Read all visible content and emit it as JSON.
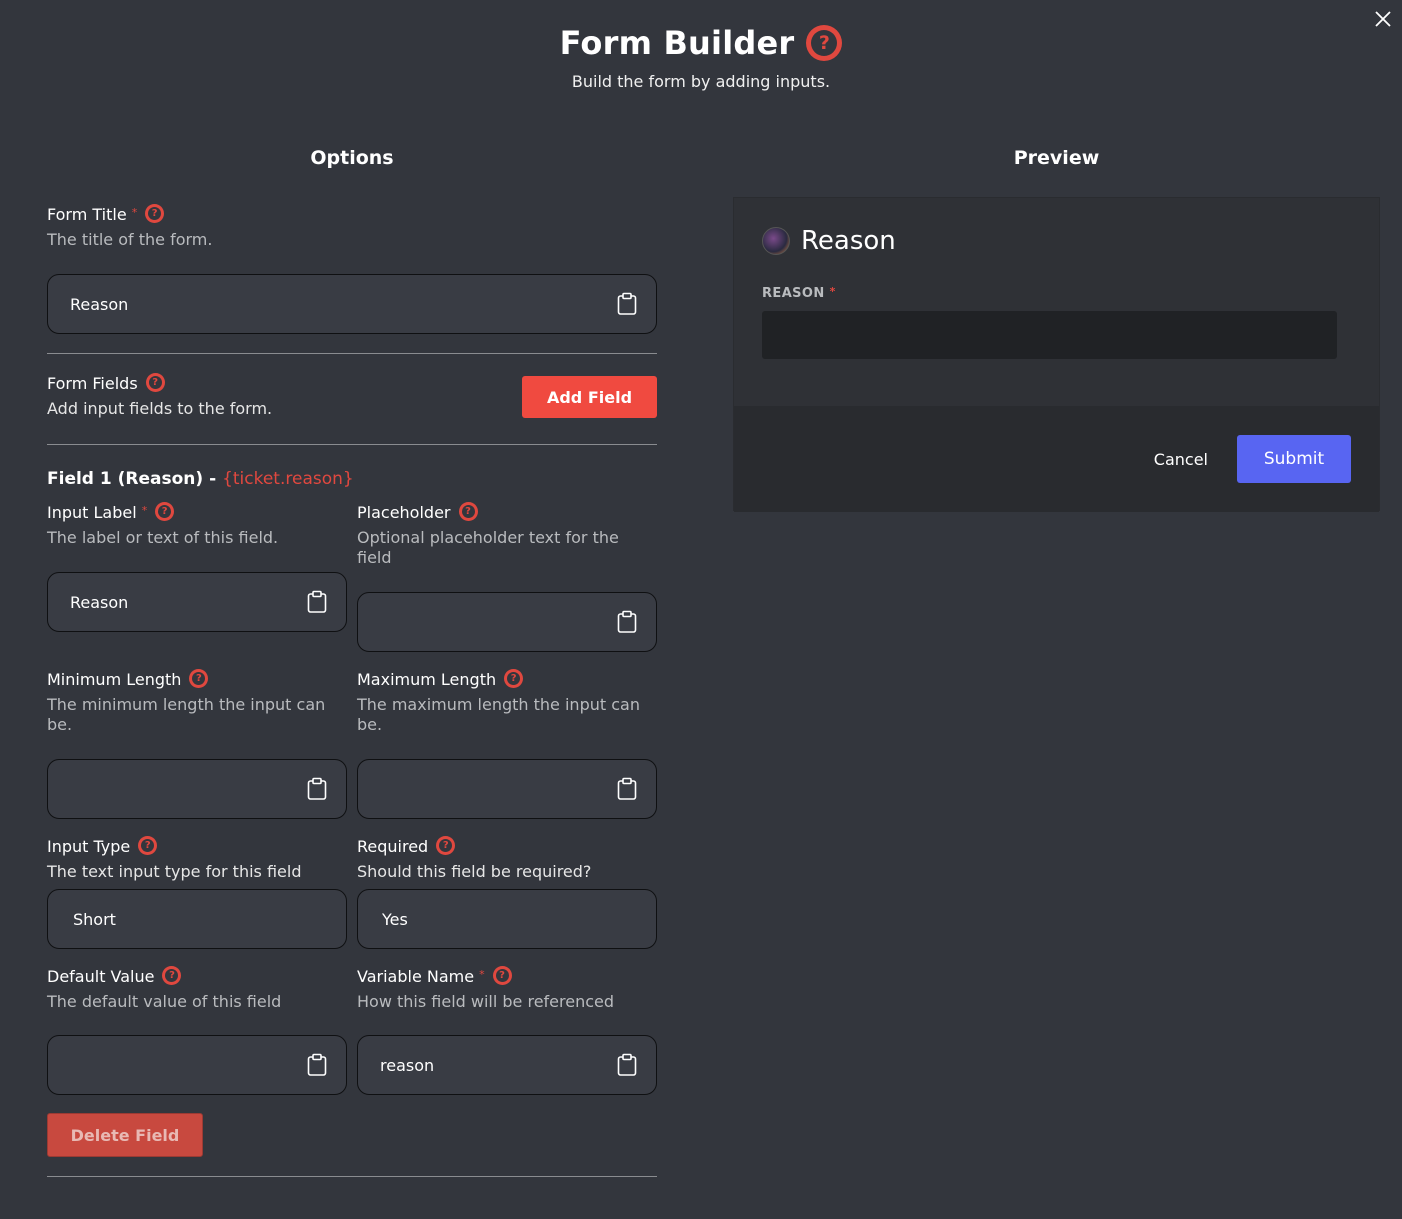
{
  "header": {
    "title": "Form Builder",
    "subtitle": "Build the form by adding inputs.",
    "help_icon": "question-circle-icon",
    "close_icon": "close-icon"
  },
  "columns": {
    "options": "Options",
    "preview": "Preview"
  },
  "form_title": {
    "label": "Form Title",
    "required_mark": "*",
    "description": "The title of the form.",
    "value": "Reason"
  },
  "form_fields": {
    "label": "Form Fields",
    "description": "Add input fields to the form.",
    "add_button": "Add Field"
  },
  "field1": {
    "title": "Field 1 (Reason) - ",
    "variable": "{ticket.reason}",
    "input_label": {
      "label": "Input Label",
      "required_mark": "*",
      "description": "The label or text of this field.",
      "value": "Reason"
    },
    "placeholder": {
      "label": "Placeholder",
      "description": "Optional placeholder text for the field",
      "value": ""
    },
    "min_length": {
      "label": "Minimum Length",
      "description": "The minimum length the input can be.",
      "value": ""
    },
    "max_length": {
      "label": "Maximum Length",
      "description": "The maximum length the input can be.",
      "value": ""
    },
    "input_type": {
      "label": "Input Type",
      "description": "The text input type for this field",
      "value": "Short"
    },
    "required": {
      "label": "Required",
      "description": "Should this field be required?",
      "value": "Yes"
    },
    "default_value": {
      "label": "Default Value",
      "description": "The default value of this field",
      "value": ""
    },
    "variable_name": {
      "label": "Variable Name",
      "required_mark": "*",
      "description": "How this field will be referenced",
      "value": "reason"
    },
    "delete_button": "Delete Field"
  },
  "preview": {
    "title": "Reason",
    "field_label": "REASON",
    "required_mark": "*",
    "cancel": "Cancel",
    "submit": "Submit"
  },
  "colors": {
    "background": "#33363d",
    "accent": "#e0483f",
    "add_button": "#f04a40",
    "submit": "#5865f2"
  }
}
